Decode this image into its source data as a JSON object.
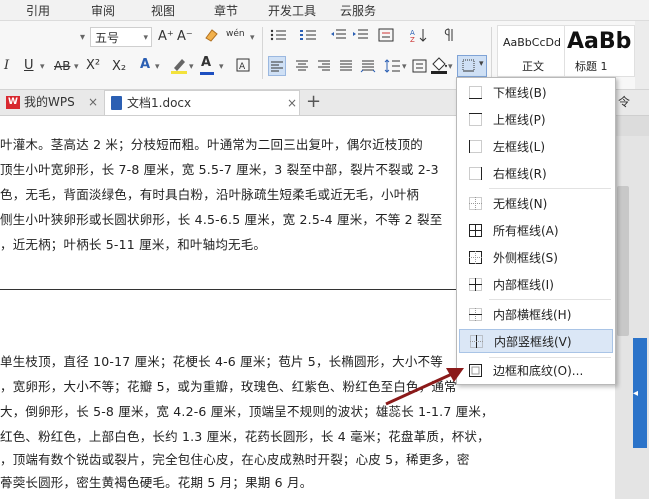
{
  "menu": {
    "items": [
      "引用",
      "审阅",
      "视图",
      "章节",
      "开发工具",
      "云服务"
    ]
  },
  "toolbar": {
    "font_size": "五号",
    "grow_font": "A⁺",
    "shrink_font": "A⁻",
    "phonetic": "wén",
    "italic": "I",
    "underline": "U",
    "strikethrough": "AB",
    "superscript": "X²",
    "subscript": "X₂",
    "font_color": "A",
    "style_normal_preview": "AaBbCcDd",
    "style_normal_label": "正文",
    "style_h1_preview": "AaBb",
    "style_h1_label": "标题 1",
    "command_fragment": "令"
  },
  "tabs": {
    "wps": "我的WPS",
    "doc": "文档1.docx"
  },
  "document": {
    "lines": [
      "叶灌木。茎高达 2 米；分枝短而粗。叶通常为二回三出复叶，偶尔近枝顶的",
      "顶生小叶宽卵形，长 7-8 厘米，宽 5.5-7 厘米，3 裂至中部，裂片不裂或 2-3",
      "色，无毛，背面淡绿色，有时具白粉，沿叶脉疏生短柔毛或近无毛，小叶柄",
      "侧生小叶狭卵形或长圆状卵形，长 4.5-6.5 厘米，宽 2.5-4 厘米，不等 2 裂至",
      "，近无柄；叶柄长 5-11 厘米，和叶轴均无毛。",
      "单生枝顶，直径 10-17 厘米；花梗长 4-6 厘米；苞片 5，长椭圆形，大小不等",
      "，宽卵形，大小不等；花瓣 5，或为重瓣，玫瑰色、红紫色、粉红色至白色，通常",
      "大，倒卵形，长 5-8 厘米，宽 4.2-6 厘米，顶端呈不规则的波状；雄蕊长 1-1.7 厘米，",
      "红色、粉红色，上部白色，长约 1.3 厘米，花药长圆形，长 4 毫米；花盘革质，杯状，",
      "，顶端有数个锐齿或裂片，完全包住心皮，在心皮成熟时开裂；心皮 5，稀更多，密",
      "蓇葖长圆形，密生黄褐色硬毛。花期 5 月；果期 6 月。"
    ]
  },
  "border_menu": {
    "items": [
      {
        "label": "下框线(B)",
        "icon": "bottom-border-icon"
      },
      {
        "label": "上框线(P)",
        "icon": "top-border-icon"
      },
      {
        "label": "左框线(L)",
        "icon": "left-border-icon"
      },
      {
        "label": "右框线(R)",
        "icon": "right-border-icon"
      },
      {
        "label": "无框线(N)",
        "icon": "no-border-icon"
      },
      {
        "label": "所有框线(A)",
        "icon": "all-borders-icon"
      },
      {
        "label": "外侧框线(S)",
        "icon": "outside-borders-icon"
      },
      {
        "label": "内部框线(I)",
        "icon": "inside-borders-icon"
      },
      {
        "label": "内部横框线(H)",
        "icon": "inside-horizontal-border-icon"
      },
      {
        "label": "内部竖框线(V)",
        "icon": "inside-vertical-border-icon"
      },
      {
        "label": "边框和底纹(O)...",
        "icon": "borders-and-shading-icon"
      }
    ],
    "highlighted_index": 9
  },
  "colors": {
    "accent_blue": "#2b5fb3",
    "highlight": "#dbe7f6",
    "arrow": "#8b1a1a",
    "font_color_bar": "#1e4fc0"
  }
}
